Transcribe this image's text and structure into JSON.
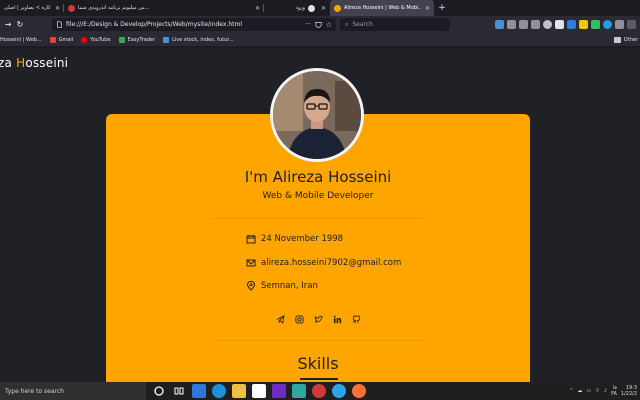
{
  "browser": {
    "tabs": [
      {
        "title": "ابعاد کاره > تصاویر | اصلی",
        "favicon_color": "#9aa0a6",
        "active": false
      },
      {
        "title": "من میلیونم برنامه اندرویدی شما...",
        "favicon_color": "#cf3a3a",
        "active": false
      },
      {
        "title": "ورود",
        "favicon_color": "#e2e2e2",
        "active": false
      },
      {
        "title": "Alireza Hosseini | Web & Mobi...",
        "favicon_color": "#ffa500",
        "active": true
      }
    ],
    "new_tab_label": "+",
    "url": "file:///E:/Design & Develop/Projects/Web/mysite/index.html",
    "search_placeholder": "Search",
    "bookmarks": [
      {
        "label": "Hosseini | Web...",
        "color": "#ffa500"
      },
      {
        "label": "Gmail",
        "color": "#ea4335"
      },
      {
        "label": "YouTube",
        "color": "#ff0000"
      },
      {
        "label": "EasyTrader",
        "color": "#3aa757"
      },
      {
        "label": "Live stock, index, futur...",
        "color": "#4a90d9"
      }
    ],
    "other_bookmarks": "Other"
  },
  "site": {
    "logo_first": "za ",
    "logo_accent": "H",
    "logo_rest": "osseini",
    "greeting": "I'm ",
    "name": "Alireza Hosseini",
    "role": "Web & Mobile Developer",
    "birthdate": "24 November 1998",
    "email": "alireza.hosseini7902@gmail.com",
    "location": "Semnan, Iran",
    "socials": [
      "telegram-icon",
      "instagram-icon",
      "twitter-icon",
      "linkedin-icon",
      "github-icon"
    ],
    "skills_heading": "Skills",
    "accent_color": "#ffa500"
  },
  "taskbar": {
    "search_placeholder": "Type here to search",
    "language": "FA",
    "time": "19:3",
    "date": "1/22/2",
    "lang_top": "فا"
  }
}
